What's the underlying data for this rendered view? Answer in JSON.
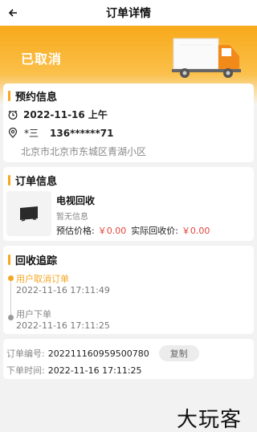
{
  "header": {
    "title": "订单详情"
  },
  "status": {
    "label": "已取消"
  },
  "booking": {
    "section_title": "预约信息",
    "date": "2022-11-16 上午",
    "contact_name": "*三",
    "contact_phone": "136******71",
    "address": "北京市北京市东城区青湖小区"
  },
  "order": {
    "section_title": "订单信息",
    "product_name": "电视回收",
    "product_desc": "暂无信息",
    "est_price_label": "预估价格:",
    "est_price": "￥0.00",
    "actual_price_label": "实际回收价:",
    "actual_price": "￥0.00"
  },
  "tracking": {
    "section_title": "回收追踪",
    "events": [
      {
        "label": "用户取消订单",
        "time": "2022-11-16 17:11:49",
        "color": "#f5a623"
      },
      {
        "label": "用户下单",
        "time": "2022-11-16 17:11:25",
        "color": "#999999"
      }
    ]
  },
  "meta": {
    "order_no_label": "订单编号:",
    "order_no": "202211160959500780",
    "copy_label": "复制",
    "order_time_label": "下单时间:",
    "order_time": "2022-11-16 17:11:25"
  },
  "watermark": {
    "text": "大玩客"
  },
  "colors": {
    "accent": "#f5a623",
    "price": "#e0443a"
  }
}
